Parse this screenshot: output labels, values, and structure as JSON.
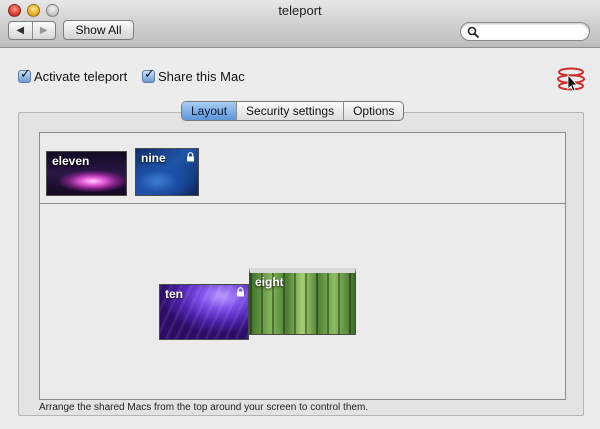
{
  "window": {
    "title": "teleport"
  },
  "toolbar": {
    "show_all_label": "Show All",
    "back_glyph": "◀",
    "forward_glyph": "▶",
    "search_placeholder": ""
  },
  "checkboxes": [
    {
      "label": "Activate teleport",
      "checked": true
    },
    {
      "label": "Share this Mac",
      "checked": true
    }
  ],
  "tabs": [
    {
      "label": "Layout",
      "active": true
    },
    {
      "label": "Security settings",
      "active": false
    },
    {
      "label": "Options",
      "active": false
    }
  ],
  "shared_macs": [
    {
      "name": "eleven",
      "locked": false
    },
    {
      "name": "nine",
      "locked": true
    }
  ],
  "arranged_macs": [
    {
      "name": "ten",
      "locked": true
    },
    {
      "name": "eight",
      "locked": false
    }
  ],
  "hint": "Arrange the shared Macs from the top around your screen to control them.",
  "icons": {
    "status": "teleport-status-icon",
    "search": "magnifier-icon",
    "lock": "lock-icon"
  },
  "colors": {
    "accent_tab": "#5d95d9",
    "checkbox": "#6a9ad4",
    "status_icon": "#d32a2a"
  }
}
